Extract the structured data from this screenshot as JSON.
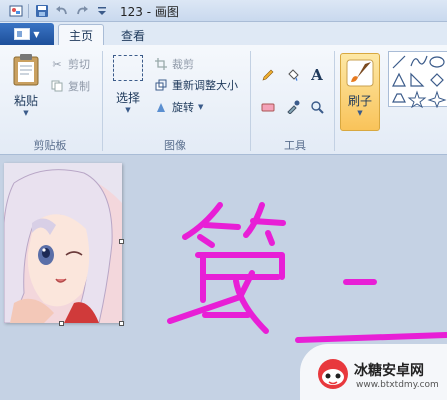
{
  "window": {
    "title": "123 - 画图"
  },
  "quick_access": {
    "icons": [
      "save-icon",
      "undo-icon",
      "redo-icon",
      "customize-dropdown-icon"
    ]
  },
  "tabs": [
    {
      "label": "主页",
      "active": true
    },
    {
      "label": "查看",
      "active": false
    }
  ],
  "ribbon": {
    "clipboard": {
      "group_label": "剪贴板",
      "paste_label": "粘贴",
      "cut_label": "剪切",
      "copy_label": "复制"
    },
    "image": {
      "group_label": "图像",
      "select_label": "选择",
      "crop_label": "裁剪",
      "resize_label": "重新调整大小",
      "rotate_label": "旋转"
    },
    "tools": {
      "group_label": "工具",
      "items": [
        "pencil-icon",
        "fill-icon",
        "text-icon",
        "eraser-icon",
        "color-picker-icon",
        "magnifier-icon"
      ]
    },
    "brushes": {
      "label": "刷子"
    },
    "shapes": {
      "items": [
        "line-icon",
        "curve-icon",
        "oval-icon",
        "rectangle-icon",
        "rounded-rectangle-icon",
        "polygon-icon",
        "triangle-icon",
        "right-triangle-icon",
        "diamond-icon",
        "pentagon-icon",
        "hexagon-icon",
        "right-arrow-icon",
        "left-arrow-icon",
        "up-arrow-icon",
        "down-arrow-icon",
        "star4-icon",
        "star5-icon",
        "star6-icon"
      ]
    }
  },
  "canvas": {
    "stroke_color": "#e81fd6"
  },
  "watermark": {
    "title": "冰糖安卓网",
    "url": "www.btxtdmy.com"
  },
  "colors": {
    "accent": "#1d4f9a",
    "brush_active": "#f9c35a"
  }
}
